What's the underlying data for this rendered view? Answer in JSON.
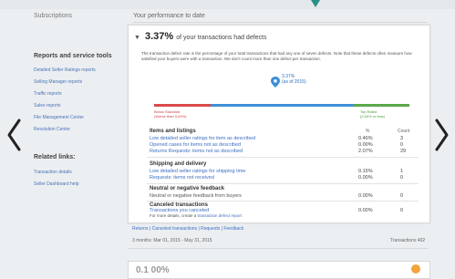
{
  "sidebar": {
    "subscriptions": "Subscriptions",
    "reports_heading": "Reports and service tools",
    "links": [
      "Detailed Seller Ratings reports",
      "Selling Manager reports",
      "Traffic reports",
      "Sales reports",
      "File Management Center",
      "Resolution Center"
    ],
    "related_heading": "Related links:",
    "related_links": [
      "Transaction details",
      "Seller Dashboard help"
    ]
  },
  "main": {
    "title": "Your performance to date",
    "card": {
      "percent": "3.37%",
      "headline": "of your transactions had defects",
      "description": "The transaction defect rate is the percentage of your total transactions that had any one of seven defects. Note that these defects often measure how satisfied your buyers were with a transaction. We don't count more than one defect per transaction.",
      "marker_value": "3.37%",
      "marker_sub": "(as of 2015)",
      "below_standard_label": "Below Standard",
      "below_standard_sub": "(Worse than 5.00%)",
      "top_rated_label": "Top Rated",
      "top_rated_sub": "(2.00% or less)",
      "col_percent": "%",
      "col_count": "Count",
      "sections": [
        {
          "heading": "Items and listings",
          "rows": [
            {
              "label": "Low detailed seller ratings for item as described",
              "percent": "0.46%",
              "count": "3"
            },
            {
              "label": "Opened cases for items not as described",
              "percent": "0.00%",
              "count": "0"
            },
            {
              "label": "Returns Requests: items not as described",
              "percent": "2.07%",
              "count": "29"
            }
          ]
        },
        {
          "heading": "Shipping and delivery",
          "rows": [
            {
              "label": "Low detailed seller ratings for shipping time",
              "percent": "0.15%",
              "count": "1"
            },
            {
              "label": "Requests: items not received",
              "percent": "0.00%",
              "count": "0"
            }
          ]
        },
        {
          "heading": "Neutral or negative feedback",
          "rows": [
            {
              "label": "Neutral or negative feedback from buyers",
              "percent": "0.00%",
              "count": "0"
            }
          ]
        },
        {
          "heading": "Canceled transactions",
          "rows": [
            {
              "label": "Transactions you canceled",
              "percent": "0.00%",
              "count": "0"
            }
          ]
        }
      ],
      "footnote_prefix": "For more details, create a",
      "footnote_link": "transaction defect report"
    },
    "links_line": "Returns | Canceled transactions | Requests | Feedback",
    "date_range": "3 months: Mar 01, 2015 - May 31, 2015",
    "transactions": "Transactions 402",
    "next_card_percent": "0.1 00%"
  },
  "nav": {
    "prev": "previous-arrow",
    "next": "next-arrow"
  },
  "colors": {
    "below_standard": "#d94b4b",
    "average": "#3d8fd6",
    "top_rated": "#5aa84a",
    "link": "#3b6fc2",
    "accent": "#2a8f88"
  }
}
